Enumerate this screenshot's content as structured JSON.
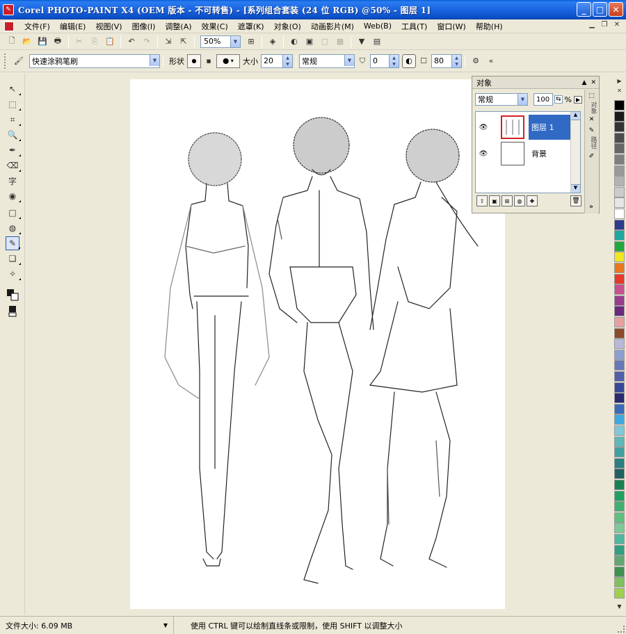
{
  "window": {
    "title": "Corel PHOTO-PAINT X4 (OEM 版本 - 不可转售) - [系列组合套装 (24 位 RGB) @50% - 图层 1]",
    "controls": [
      "_",
      "□",
      "✕"
    ]
  },
  "menu": [
    "文件(F)",
    "编辑(E)",
    "视图(V)",
    "图像(I)",
    "调整(A)",
    "效果(C)",
    "遮罩(K)",
    "对象(O)",
    "动画影片(M)",
    "Web(B)",
    "工具(T)",
    "窗口(W)",
    "帮助(H)"
  ],
  "toolbar": {
    "zoom": "50%"
  },
  "property_bar": {
    "brush_name": "快速涂鸦笔刷",
    "shape_label": "形状",
    "size_label": "大小",
    "size_value": "20",
    "mode": "常规",
    "transparency": "0",
    "amount": "80"
  },
  "objects_docker": {
    "title": "对象",
    "blend_mode": "常规",
    "opacity": "100",
    "opacity_unit": "%",
    "layers": [
      {
        "name": "图层 1",
        "selected": true
      },
      {
        "name": "背景",
        "selected": false
      }
    ],
    "tabs": [
      "对象",
      "路径"
    ]
  },
  "palette": {
    "colors": [
      "#000000",
      "#1a1a1a",
      "#333333",
      "#4d4d4d",
      "#666666",
      "#808080",
      "#999999",
      "#b3b3b3",
      "#cccccc",
      "#e6e6e6",
      "#ffffff",
      "#2e3a8c",
      "#1fa7a0",
      "#22a93c",
      "#f0e81e",
      "#e8781e",
      "#e63a2a",
      "#c8508c",
      "#9a3c8c",
      "#6a2a7c",
      "#e8a0a0",
      "#8c4a2a",
      "#b8b8d8",
      "#8ca0d0",
      "#6878b8",
      "#5060a8",
      "#384898",
      "#2a2a70",
      "#3a6ab8",
      "#40a8e0",
      "#80c8d8",
      "#60b8b8",
      "#40a0a0",
      "#2a8080",
      "#206060",
      "#1a8050",
      "#20a060",
      "#40b070",
      "#60c080",
      "#80c898",
      "#50b8a0",
      "#30a080",
      "#60a870",
      "#409050",
      "#80c060",
      "#a0d050"
    ]
  },
  "status": {
    "file_size": "文件大小: 6.09 MB",
    "hint": "使用 CTRL 键可以绘制直线条或限制，使用 SHIFT 以调整大小"
  }
}
